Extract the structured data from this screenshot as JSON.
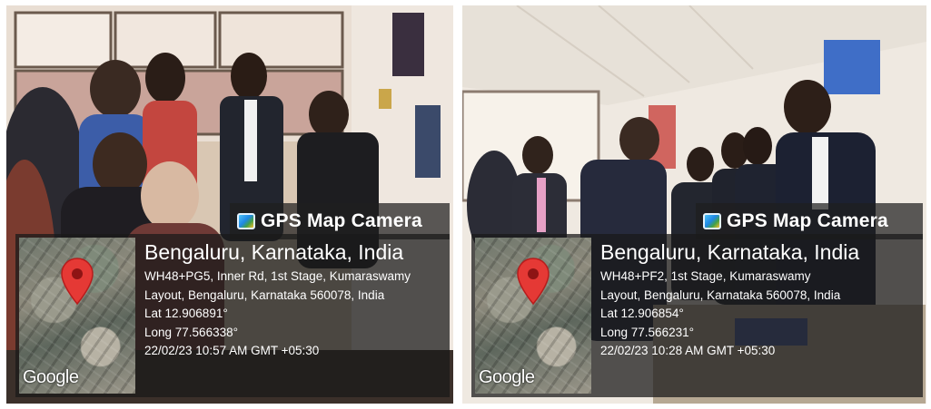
{
  "photos": [
    {
      "badge": "GPS Map Camera",
      "location_title": "Bengaluru, Karnataka, India",
      "address_line1": "WH48+PG5, Inner Rd, 1st Stage, Kumaraswamy",
      "address_line2": "Layout, Bengaluru, Karnataka 560078, India",
      "lat": "Lat 12.906891°",
      "long": "Long 77.566338°",
      "timestamp": "22/02/23 10:57 AM GMT +05:30",
      "map_logo": "Google"
    },
    {
      "badge": "GPS Map Camera",
      "location_title": "Bengaluru, Karnataka, India",
      "address_line1": "WH48+PF2, 1st Stage, Kumaraswamy",
      "address_line2": "Layout, Bengaluru, Karnataka 560078, India",
      "lat": "Lat 12.906854°",
      "long": "Long 77.566231°",
      "timestamp": "22/02/23 10:28 AM GMT +05:30",
      "map_logo": "Google"
    }
  ],
  "colors": {
    "pin": "#e53935",
    "overlay": "#1e1e1e",
    "overlay_text": "#ffffff"
  }
}
